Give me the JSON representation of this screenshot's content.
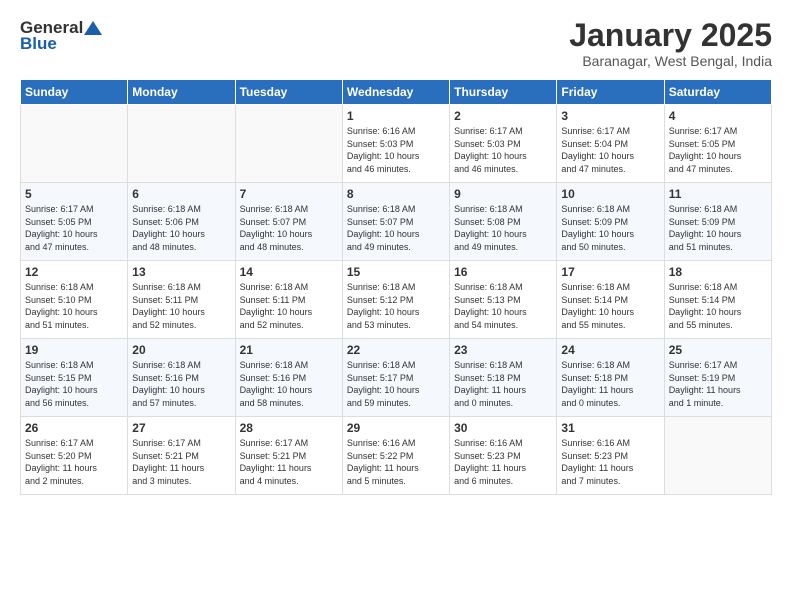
{
  "header": {
    "logo_general": "General",
    "logo_blue": "Blue",
    "month_title": "January 2025",
    "location": "Baranagar, West Bengal, India"
  },
  "days_of_week": [
    "Sunday",
    "Monday",
    "Tuesday",
    "Wednesday",
    "Thursday",
    "Friday",
    "Saturday"
  ],
  "weeks": [
    [
      {
        "num": "",
        "info": ""
      },
      {
        "num": "",
        "info": ""
      },
      {
        "num": "",
        "info": ""
      },
      {
        "num": "1",
        "info": "Sunrise: 6:16 AM\nSunset: 5:03 PM\nDaylight: 10 hours\nand 46 minutes."
      },
      {
        "num": "2",
        "info": "Sunrise: 6:17 AM\nSunset: 5:03 PM\nDaylight: 10 hours\nand 46 minutes."
      },
      {
        "num": "3",
        "info": "Sunrise: 6:17 AM\nSunset: 5:04 PM\nDaylight: 10 hours\nand 47 minutes."
      },
      {
        "num": "4",
        "info": "Sunrise: 6:17 AM\nSunset: 5:05 PM\nDaylight: 10 hours\nand 47 minutes."
      }
    ],
    [
      {
        "num": "5",
        "info": "Sunrise: 6:17 AM\nSunset: 5:05 PM\nDaylight: 10 hours\nand 47 minutes."
      },
      {
        "num": "6",
        "info": "Sunrise: 6:18 AM\nSunset: 5:06 PM\nDaylight: 10 hours\nand 48 minutes."
      },
      {
        "num": "7",
        "info": "Sunrise: 6:18 AM\nSunset: 5:07 PM\nDaylight: 10 hours\nand 48 minutes."
      },
      {
        "num": "8",
        "info": "Sunrise: 6:18 AM\nSunset: 5:07 PM\nDaylight: 10 hours\nand 49 minutes."
      },
      {
        "num": "9",
        "info": "Sunrise: 6:18 AM\nSunset: 5:08 PM\nDaylight: 10 hours\nand 49 minutes."
      },
      {
        "num": "10",
        "info": "Sunrise: 6:18 AM\nSunset: 5:09 PM\nDaylight: 10 hours\nand 50 minutes."
      },
      {
        "num": "11",
        "info": "Sunrise: 6:18 AM\nSunset: 5:09 PM\nDaylight: 10 hours\nand 51 minutes."
      }
    ],
    [
      {
        "num": "12",
        "info": "Sunrise: 6:18 AM\nSunset: 5:10 PM\nDaylight: 10 hours\nand 51 minutes."
      },
      {
        "num": "13",
        "info": "Sunrise: 6:18 AM\nSunset: 5:11 PM\nDaylight: 10 hours\nand 52 minutes."
      },
      {
        "num": "14",
        "info": "Sunrise: 6:18 AM\nSunset: 5:11 PM\nDaylight: 10 hours\nand 52 minutes."
      },
      {
        "num": "15",
        "info": "Sunrise: 6:18 AM\nSunset: 5:12 PM\nDaylight: 10 hours\nand 53 minutes."
      },
      {
        "num": "16",
        "info": "Sunrise: 6:18 AM\nSunset: 5:13 PM\nDaylight: 10 hours\nand 54 minutes."
      },
      {
        "num": "17",
        "info": "Sunrise: 6:18 AM\nSunset: 5:14 PM\nDaylight: 10 hours\nand 55 minutes."
      },
      {
        "num": "18",
        "info": "Sunrise: 6:18 AM\nSunset: 5:14 PM\nDaylight: 10 hours\nand 55 minutes."
      }
    ],
    [
      {
        "num": "19",
        "info": "Sunrise: 6:18 AM\nSunset: 5:15 PM\nDaylight: 10 hours\nand 56 minutes."
      },
      {
        "num": "20",
        "info": "Sunrise: 6:18 AM\nSunset: 5:16 PM\nDaylight: 10 hours\nand 57 minutes."
      },
      {
        "num": "21",
        "info": "Sunrise: 6:18 AM\nSunset: 5:16 PM\nDaylight: 10 hours\nand 58 minutes."
      },
      {
        "num": "22",
        "info": "Sunrise: 6:18 AM\nSunset: 5:17 PM\nDaylight: 10 hours\nand 59 minutes."
      },
      {
        "num": "23",
        "info": "Sunrise: 6:18 AM\nSunset: 5:18 PM\nDaylight: 11 hours\nand 0 minutes."
      },
      {
        "num": "24",
        "info": "Sunrise: 6:18 AM\nSunset: 5:18 PM\nDaylight: 11 hours\nand 0 minutes."
      },
      {
        "num": "25",
        "info": "Sunrise: 6:17 AM\nSunset: 5:19 PM\nDaylight: 11 hours\nand 1 minute."
      }
    ],
    [
      {
        "num": "26",
        "info": "Sunrise: 6:17 AM\nSunset: 5:20 PM\nDaylight: 11 hours\nand 2 minutes."
      },
      {
        "num": "27",
        "info": "Sunrise: 6:17 AM\nSunset: 5:21 PM\nDaylight: 11 hours\nand 3 minutes."
      },
      {
        "num": "28",
        "info": "Sunrise: 6:17 AM\nSunset: 5:21 PM\nDaylight: 11 hours\nand 4 minutes."
      },
      {
        "num": "29",
        "info": "Sunrise: 6:16 AM\nSunset: 5:22 PM\nDaylight: 11 hours\nand 5 minutes."
      },
      {
        "num": "30",
        "info": "Sunrise: 6:16 AM\nSunset: 5:23 PM\nDaylight: 11 hours\nand 6 minutes."
      },
      {
        "num": "31",
        "info": "Sunrise: 6:16 AM\nSunset: 5:23 PM\nDaylight: 11 hours\nand 7 minutes."
      },
      {
        "num": "",
        "info": ""
      }
    ]
  ]
}
